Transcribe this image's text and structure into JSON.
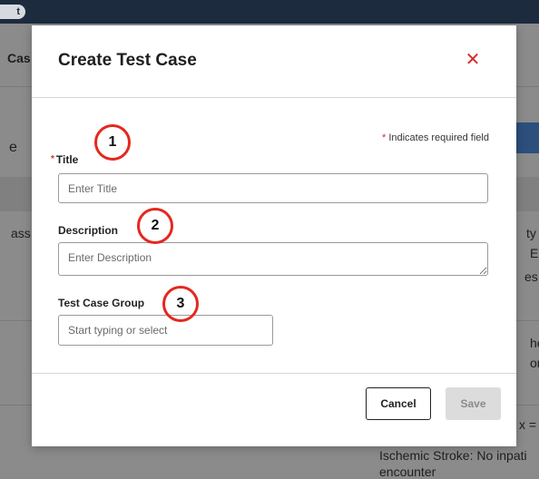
{
  "background": {
    "pill_label": "t",
    "left_texts": [
      "Cas",
      "e",
      "ass"
    ],
    "right_texts": [
      "ty",
      "E",
      "es",
      "he",
      "or",
      "x ="
    ],
    "bottom_texts": [
      "Ischemic Stroke: No inpati",
      "encounter"
    ]
  },
  "modal": {
    "title": "Create Test Case",
    "close_symbol": "✕",
    "required_note_asterisk": "*",
    "required_note": "Indicates required field"
  },
  "fields": {
    "title": {
      "asterisk": "*",
      "label": "Title",
      "placeholder": "Enter Title"
    },
    "description": {
      "label": "Description",
      "placeholder": "Enter Description"
    },
    "group": {
      "label": "Test Case Group",
      "placeholder": "Start typing or select"
    }
  },
  "footer": {
    "cancel_label": "Cancel",
    "save_label": "Save"
  },
  "annotations": [
    "1",
    "2",
    "3"
  ],
  "colors": {
    "accent_red": "#d62b2b",
    "callout_red": "#e4281f",
    "nav_dark": "#1c2b3e"
  }
}
